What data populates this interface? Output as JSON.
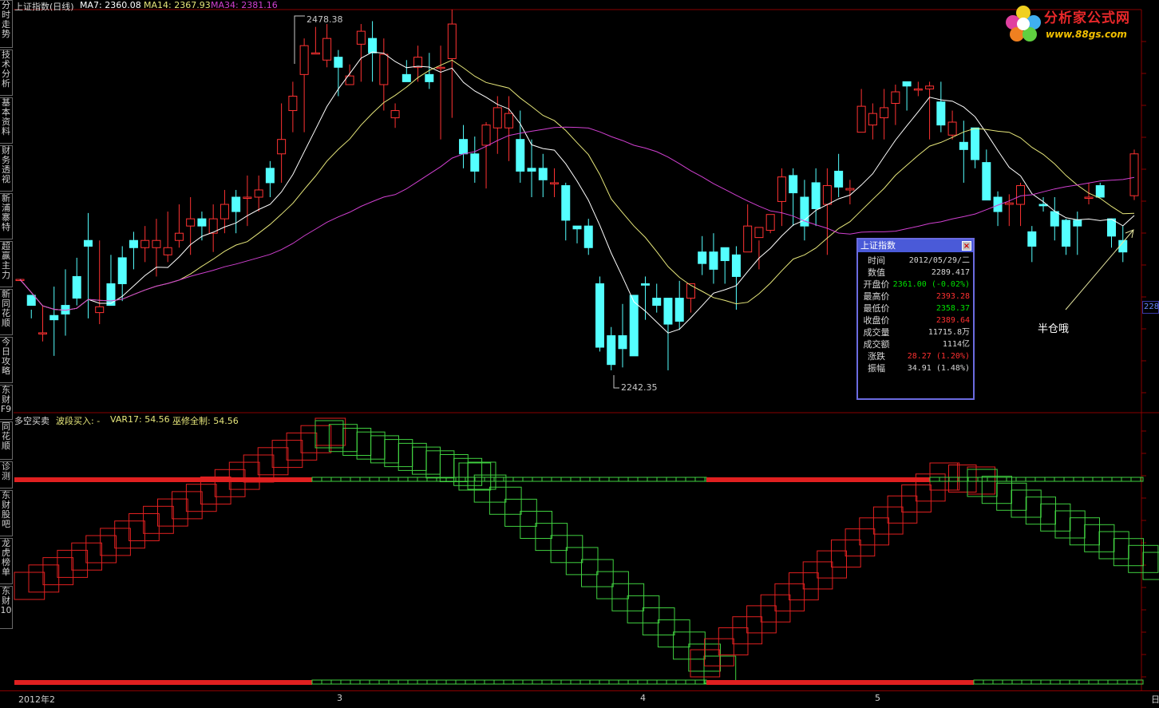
{
  "sidebar": {
    "items": [
      "分时走势",
      "技术分析",
      "基本资料",
      "财务透视",
      "新浦寨特",
      "超赢主力",
      "新同花顺",
      "今日攻略",
      "东财F9",
      "同花顺",
      "诊测",
      "东财股吧",
      "龙虎榜单",
      "东财10"
    ]
  },
  "header": {
    "title": "上证指数(日线)",
    "ma7": "MA7: 2360.08",
    "ma14": "MA14: 2367.93",
    "ma34": "MA34: 2381.16"
  },
  "indicator_header": {
    "name": "多空买卖",
    "buy": "波段买入: -",
    "var17": "VAR17: 54.56",
    "wuxiu": "巫修全制: 54.56"
  },
  "logo": {
    "cn": "分析家公式网",
    "url": "www.88gs.com"
  },
  "annotations": {
    "high": "2478.38",
    "low": "2242.35",
    "half": "半仓哦"
  },
  "price_tag": "228",
  "popup": {
    "title": "上证指数",
    "close": "×",
    "rows": [
      {
        "label": "时间",
        "value": "2012/05/29/二",
        "color": "#d8d8d8"
      },
      {
        "label": "数值",
        "value": "2289.417",
        "color": "#d8d8d8"
      },
      {
        "label": "开盘价",
        "value": "2361.00 (-0.02%)",
        "color": "#00e000"
      },
      {
        "label": "最高价",
        "value": "2393.28",
        "color": "#ff3030"
      },
      {
        "label": "最低价",
        "value": "2358.37",
        "color": "#00e000"
      },
      {
        "label": "收盘价",
        "value": "2389.64",
        "color": "#ff3030"
      },
      {
        "label": "成交量",
        "value": "11715.8万",
        "color": "#d8d8d8"
      },
      {
        "label": "成交额",
        "value": "1114亿",
        "color": "#d8d8d8"
      },
      {
        "label": "涨跌",
        "value": "28.27 (1.20%)",
        "color": "#ff3030"
      },
      {
        "label": "振幅",
        "value": "34.91 (1.48%)",
        "color": "#d8d8d8"
      }
    ]
  },
  "xaxis": {
    "labels": [
      "2012年2",
      "3",
      "4",
      "5"
    ],
    "corner": "日"
  },
  "colors": {
    "up": "#ff3232",
    "down": "#54ffff",
    "ma7": "#ffffff",
    "ma14": "#e6e67a",
    "ma34": "#d040d0",
    "red_box": "#e02020",
    "green_box": "#40d040"
  },
  "chart_data": {
    "type": "candlestick",
    "y_range": [
      2230,
      2490
    ],
    "candles": [
      [
        2303,
        2303,
        2280,
        2280
      ],
      [
        2292,
        2285,
        2282,
        2276
      ],
      [
        2266,
        2266,
        2285,
        2260
      ],
      [
        2278,
        2275,
        2298,
        2250
      ],
      [
        2285,
        2279,
        2310,
        2264
      ],
      [
        2305,
        2290,
        2318,
        2285
      ],
      [
        2330,
        2326,
        2349,
        2276
      ],
      [
        2280,
        2284,
        2330,
        2272
      ],
      [
        2300,
        2285,
        2320,
        2290
      ],
      [
        2318,
        2300,
        2326,
        2288
      ],
      [
        2330,
        2325,
        2336,
        2310
      ],
      [
        2325,
        2330,
        2340,
        2315
      ],
      [
        2325,
        2330,
        2345,
        2305
      ],
      [
        2320,
        2325,
        2350,
        2315
      ],
      [
        2330,
        2335,
        2355,
        2325
      ],
      [
        2340,
        2345,
        2360,
        2320
      ],
      [
        2345,
        2340,
        2350,
        2330
      ],
      [
        2335,
        2345,
        2355,
        2322
      ],
      [
        2345,
        2355,
        2365,
        2335
      ],
      [
        2360,
        2350,
        2365,
        2335
      ],
      [
        2360,
        2360,
        2375,
        2340
      ],
      [
        2360,
        2365,
        2375,
        2350
      ],
      [
        2380,
        2370,
        2385,
        2360
      ],
      [
        2390,
        2400,
        2425,
        2370
      ],
      [
        2420,
        2430,
        2440,
        2405
      ],
      [
        2445,
        2465,
        2470,
        2405
      ],
      [
        2460,
        2460,
        2478,
        2460
      ],
      [
        2455,
        2470,
        2480,
        2450
      ],
      [
        2457,
        2450,
        2462,
        2430
      ],
      [
        2438,
        2444,
        2452,
        2440
      ],
      [
        2466,
        2475,
        2480,
        2440
      ],
      [
        2470,
        2460,
        2482,
        2440
      ],
      [
        2438,
        2459,
        2470,
        2420
      ],
      [
        2415,
        2420,
        2425,
        2408
      ],
      [
        2445,
        2440,
        2455,
        2440
      ],
      [
        2450,
        2457,
        2465,
        2440
      ],
      [
        2445,
        2440,
        2460,
        2435
      ],
      [
        2450,
        2450,
        2465,
        2400
      ],
      [
        2456,
        2480,
        2490,
        2415
      ],
      [
        2400,
        2390,
        2410,
        2380
      ],
      [
        2390,
        2378,
        2402,
        2370
      ],
      [
        2396,
        2410,
        2412,
        2366
      ],
      [
        2408,
        2422,
        2430,
        2390
      ],
      [
        2408,
        2418,
        2430,
        2385
      ],
      [
        2400,
        2378,
        2420,
        2370
      ],
      [
        2380,
        2378,
        2400,
        2360
      ],
      [
        2380,
        2372,
        2390,
        2360
      ],
      [
        2370,
        2370,
        2380,
        2360
      ],
      [
        2368,
        2344,
        2370,
        2330
      ],
      [
        2340,
        2338,
        2340,
        2328
      ],
      [
        2340,
        2325,
        2345,
        2320
      ],
      [
        2300,
        2256,
        2305,
        2253
      ],
      [
        2264,
        2244,
        2270,
        2240
      ],
      [
        2264,
        2255,
        2286,
        2242
      ],
      [
        2292,
        2250,
        2290,
        2250
      ],
      [
        2300,
        2299,
        2305,
        2275
      ],
      [
        2290,
        2285,
        2300,
        2280
      ],
      [
        2290,
        2272,
        2288,
        2240
      ],
      [
        2290,
        2274,
        2302,
        2268
      ],
      [
        2290,
        2300,
        2300,
        2280
      ],
      [
        2322,
        2314,
        2333,
        2306
      ],
      [
        2322,
        2310,
        2335,
        2300
      ],
      [
        2325,
        2316,
        2322,
        2300
      ],
      [
        2320,
        2305,
        2326,
        2282
      ],
      [
        2322,
        2340,
        2355,
        2330
      ],
      [
        2332,
        2339,
        2330,
        2310
      ],
      [
        2337,
        2348,
        2348,
        2335
      ],
      [
        2357,
        2374,
        2380,
        2340
      ],
      [
        2375,
        2363,
        2380,
        2340
      ],
      [
        2360,
        2340,
        2372,
        2330
      ],
      [
        2370,
        2352,
        2380,
        2340
      ],
      [
        2355,
        2368,
        2380,
        2320
      ],
      [
        2378,
        2367,
        2390,
        2360
      ],
      [
        2365,
        2366,
        2372,
        2355
      ],
      [
        2405,
        2423,
        2435,
        2405
      ],
      [
        2410,
        2418,
        2425,
        2400
      ],
      [
        2415,
        2422,
        2435,
        2400
      ],
      [
        2425,
        2433,
        2438,
        2410
      ],
      [
        2440,
        2437,
        2440,
        2420
      ],
      [
        2435,
        2435,
        2440,
        2430
      ],
      [
        2435,
        2437,
        2440,
        2400
      ],
      [
        2426,
        2410,
        2440,
        2405
      ],
      [
        2403,
        2412,
        2420,
        2400
      ],
      [
        2398,
        2393,
        2413,
        2370
      ],
      [
        2408,
        2386,
        2394,
        2380
      ],
      [
        2384,
        2358,
        2393,
        2380
      ],
      [
        2360,
        2350,
        2364,
        2340
      ],
      [
        2355,
        2356,
        2362,
        2340
      ],
      [
        2355,
        2368,
        2370,
        2340
      ],
      [
        2336,
        2326,
        2340,
        2315
      ],
      [
        2355,
        2354,
        2360,
        2350
      ],
      [
        2350,
        2340,
        2360,
        2330
      ],
      [
        2344,
        2326,
        2345,
        2320
      ],
      [
        2344,
        2340,
        2350,
        2320
      ],
      [
        2360,
        2360,
        2370,
        2355
      ],
      [
        2368,
        2360,
        2370,
        2360
      ],
      [
        2345,
        2333,
        2344,
        2325
      ],
      [
        2330,
        2322,
        2340,
        2315
      ],
      [
        2361,
        2390,
        2393,
        2358
      ]
    ]
  }
}
